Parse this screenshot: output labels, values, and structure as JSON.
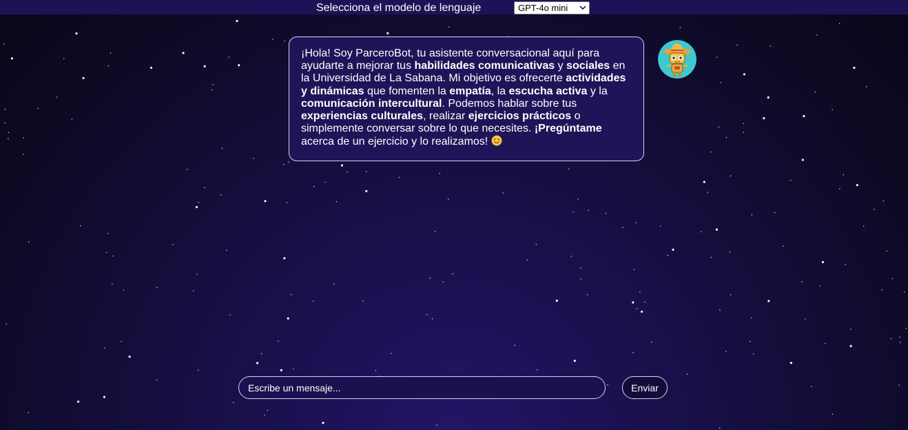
{
  "header": {
    "model_label": "Selecciona el modelo de lenguaje",
    "model_selected": "GPT-4o mini"
  },
  "chat": {
    "messages": [
      {
        "sender": "ParceroBot",
        "segments": [
          {
            "text": "¡Hola! Soy ParceroBot, tu asistente conversacional aquí para ayudarte a mejorar tus ",
            "bold": false
          },
          {
            "text": "habilidades comunicativas",
            "bold": true
          },
          {
            "text": " y ",
            "bold": false
          },
          {
            "text": "sociales",
            "bold": true
          },
          {
            "text": " en la Universidad de La Sabana. Mi objetivo es ofrecerte ",
            "bold": false
          },
          {
            "text": "actividades y dinámicas",
            "bold": true
          },
          {
            "text": " que fomenten la ",
            "bold": false
          },
          {
            "text": "empatía",
            "bold": true
          },
          {
            "text": ", la ",
            "bold": false
          },
          {
            "text": "escucha activa",
            "bold": true
          },
          {
            "text": " y la ",
            "bold": false
          },
          {
            "text": "comunicación intercultural",
            "bold": true
          },
          {
            "text": ". Podemos hablar sobre tus ",
            "bold": false
          },
          {
            "text": "experiencias culturales",
            "bold": true
          },
          {
            "text": ", realizar ",
            "bold": false
          },
          {
            "text": "ejercicios prácticos",
            "bold": true
          },
          {
            "text": " o simplemente conversar sobre lo que necesites. ",
            "bold": false
          },
          {
            "text": "¡Pregúntame",
            "bold": true
          },
          {
            "text": " acerca de un ejercicio y lo realizamos! ",
            "bold": false
          }
        ],
        "trailing_emoji": "smiling-face-icon",
        "avatar_icon": "robot-sombrero-avatar-icon"
      }
    ]
  },
  "composer": {
    "placeholder": "Escribe un mensaje...",
    "value": "",
    "send_label": "Enviar"
  },
  "colors": {
    "background_top": "#09081a",
    "background_bottom": "#221566",
    "bubble_bg": "#1f1458",
    "topbar_bg": "#1e1257",
    "border": "#d8d4f0",
    "text": "#ffffff"
  }
}
